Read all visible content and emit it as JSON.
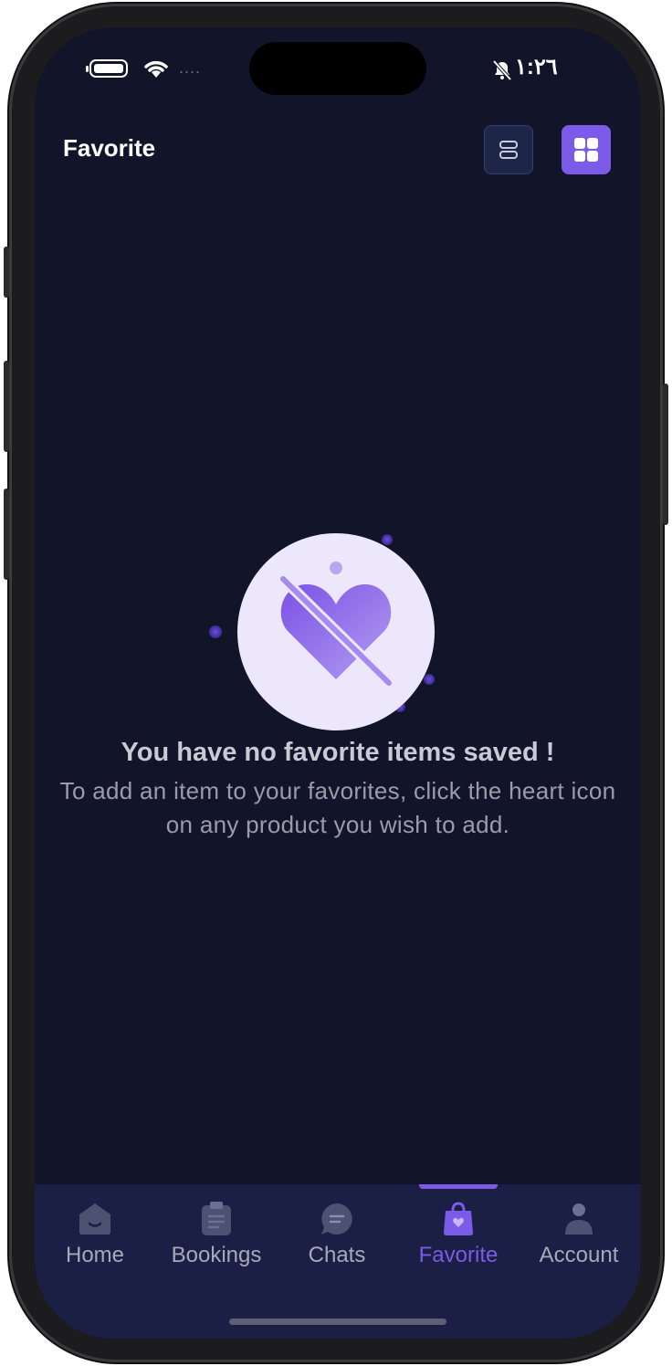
{
  "status_bar": {
    "time": "١:٢٦",
    "signal_dots": "....",
    "icons": [
      "battery-icon",
      "wifi-icon",
      "bell-muted-icon"
    ]
  },
  "header": {
    "title": "Favorite",
    "view_buttons": [
      {
        "name": "list-view",
        "icon": "list-icon",
        "active": false
      },
      {
        "name": "grid-view",
        "icon": "grid-icon",
        "active": true
      }
    ]
  },
  "empty_state": {
    "icon": "heart-slash-icon",
    "title": "You have no favorite items saved !",
    "description": "To add an item to your favorites, click the heart icon on any product you wish to add."
  },
  "tab_bar": {
    "items": [
      {
        "label": "Home",
        "icon": "home-icon"
      },
      {
        "label": "Bookings",
        "icon": "clipboard-icon"
      },
      {
        "label": "Chats",
        "icon": "chat-icon"
      },
      {
        "label": "Favorite",
        "icon": "bag-heart-icon",
        "active": true
      },
      {
        "label": "Account",
        "icon": "person-icon"
      }
    ]
  },
  "colors": {
    "background": "#12142a",
    "accent": "#7b5be8",
    "tab_bar": "#1b1f45",
    "inactive": "#a7a9ba"
  }
}
